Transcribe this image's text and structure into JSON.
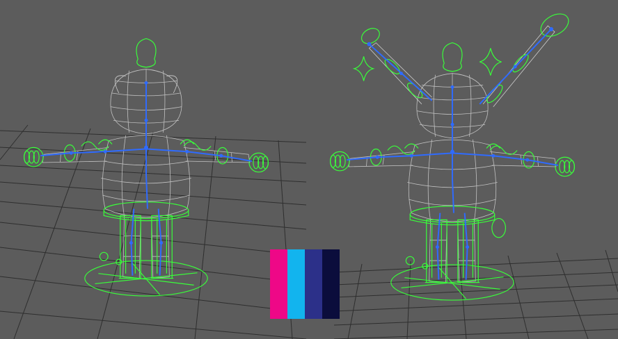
{
  "viewport": {
    "background": "#5c5c5c",
    "grid_color": "#2e2e2e",
    "mesh_color": "#cfcfcf",
    "control_color": "#39ff3a",
    "joint_color": "#2f6bff"
  },
  "palette": {
    "swatches": [
      {
        "name": "pink",
        "color": "#ee0887"
      },
      {
        "name": "cyan",
        "color": "#12b4ee"
      },
      {
        "name": "indigo",
        "color": "#2c3089"
      },
      {
        "name": "navy",
        "color": "#0b0d3c"
      }
    ]
  },
  "characters": [
    {
      "name": "rig-left",
      "antennae": false
    },
    {
      "name": "rig-right",
      "antennae": true
    }
  ]
}
